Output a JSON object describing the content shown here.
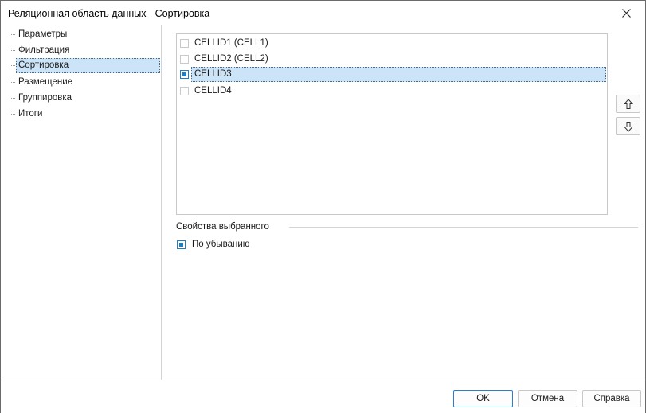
{
  "window": {
    "title": "Реляционная область данных - Сортировка"
  },
  "sidebar": {
    "items": [
      {
        "label": "Параметры"
      },
      {
        "label": "Фильтрация"
      },
      {
        "label": "Сортировка"
      },
      {
        "label": "Размещение"
      },
      {
        "label": "Группировка"
      },
      {
        "label": "Итоги"
      }
    ],
    "selected": "Сортировка"
  },
  "sort_list": {
    "items": [
      {
        "label": "CELLID1 (CELL1)",
        "checked": false
      },
      {
        "label": "CELLID2 (CELL2)",
        "checked": false
      },
      {
        "label": "CELLID3",
        "checked": true
      },
      {
        "label": "CELLID4",
        "checked": false
      }
    ],
    "selected": "CELLID3"
  },
  "properties": {
    "group_title": "Свойства выбранного",
    "descending_label": "По убыванию",
    "descending_checked": true
  },
  "footer": {
    "ok_label": "OK",
    "cancel_label": "Отмена",
    "help_label": "Справка"
  },
  "colors": {
    "accent": "#1e7fc6",
    "selection": "#cce4f7"
  }
}
